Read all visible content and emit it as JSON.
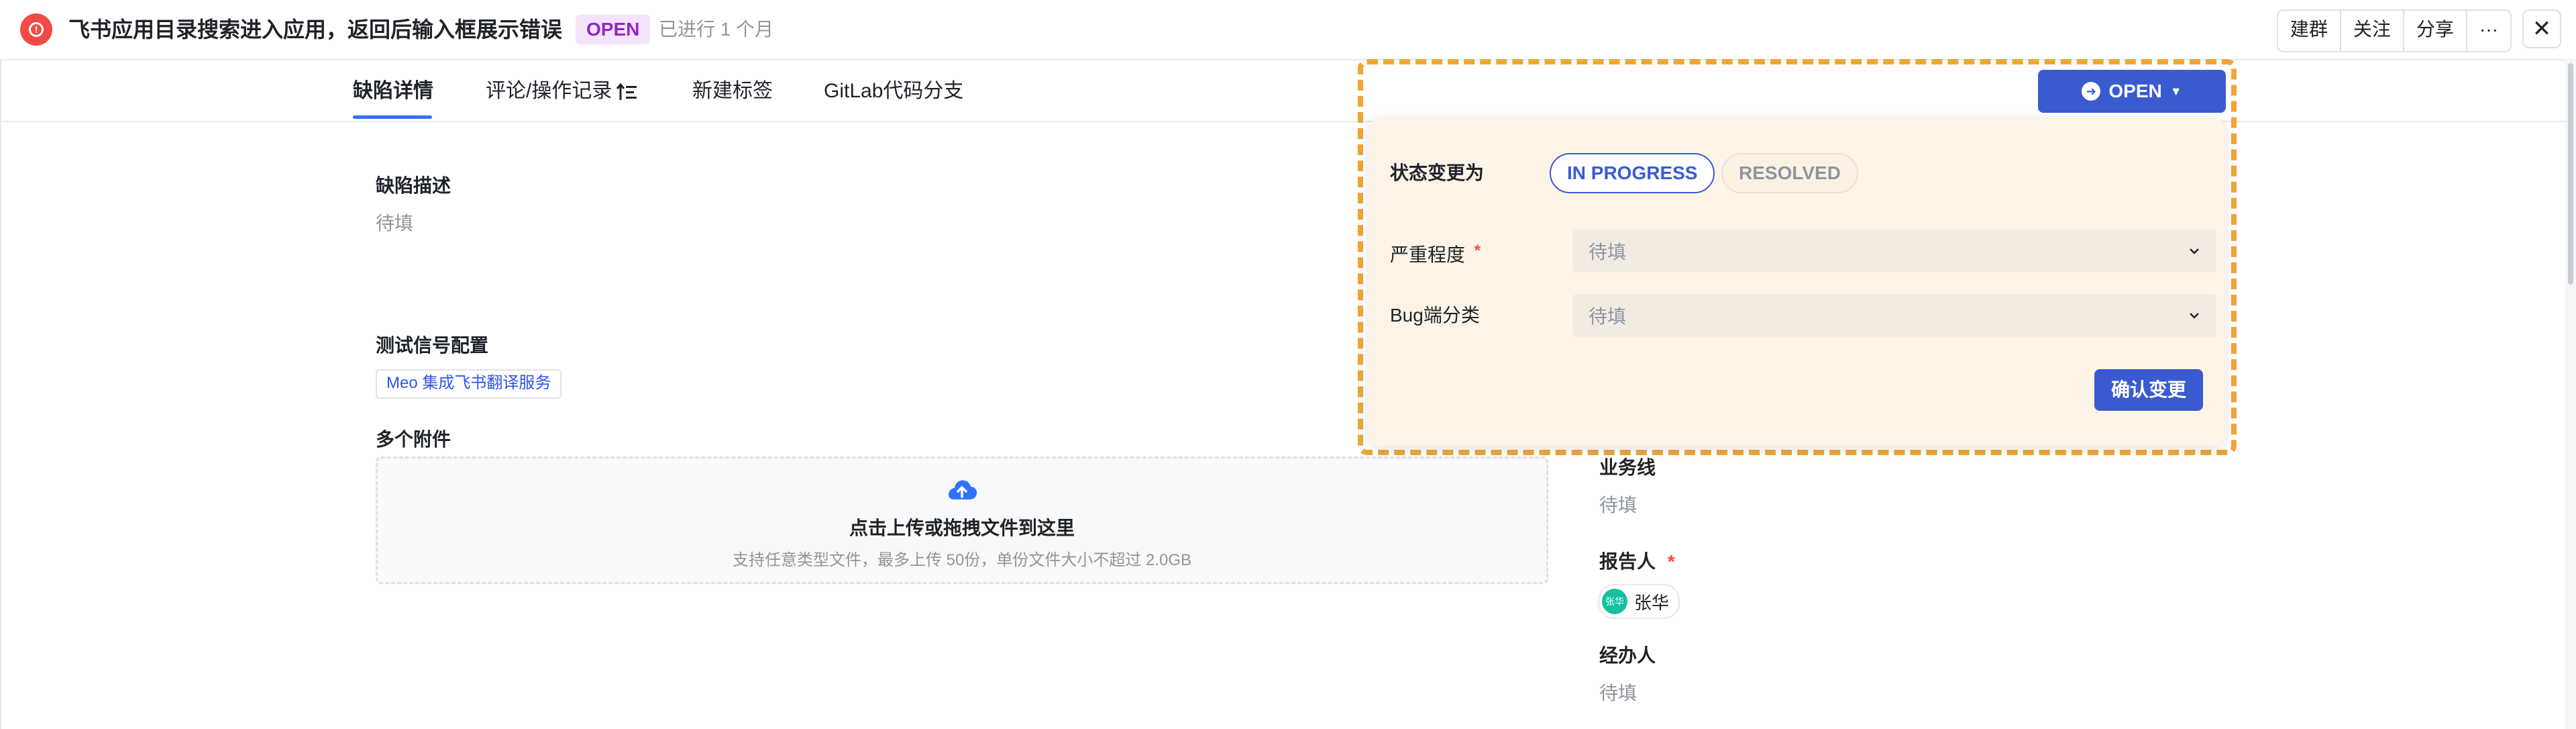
{
  "header": {
    "title": "飞书应用目录搜索进入应用，返回后输入框展示错误",
    "status_badge": "OPEN",
    "elapsed": "已进行 1 个月",
    "actions": [
      "建群",
      "关注",
      "分享",
      "···"
    ],
    "close": "✕"
  },
  "tabs": [
    {
      "label": "缺陷详情",
      "active": true
    },
    {
      "label": "评论/操作记录"
    },
    {
      "label": "新建标签"
    },
    {
      "label": "GitLab代码分支"
    }
  ],
  "left": {
    "description": {
      "label": "缺陷描述",
      "value": "待填"
    },
    "test_signal": {
      "label": "测试信号配置",
      "tag": "Meo 集成飞书翻译服务"
    },
    "attachments": {
      "label": "多个附件",
      "upload_main": "点击上传或拖拽文件到这里",
      "upload_sub": "支持任意类型文件，最多上传 50份，单份文件大小不超过 2.0GB"
    }
  },
  "right": {
    "business_line": {
      "label": "业务线",
      "value": "待填"
    },
    "reporter": {
      "label": "报告人",
      "required": "*",
      "avatar_text": "张华",
      "name": "张华"
    },
    "assignee": {
      "label": "经办人",
      "value": "待填"
    }
  },
  "status_popover": {
    "button_label": "OPEN",
    "state_change_label": "状态变更为",
    "options": [
      "IN PROGRESS",
      "RESOLVED"
    ],
    "severity": {
      "label": "严重程度",
      "required": "*",
      "placeholder": "待填"
    },
    "bug_category": {
      "label": "Bug端分类",
      "placeholder": "待填"
    },
    "confirm": "确认变更"
  },
  "colors": {
    "accent": "#3a5bcf",
    "highlight_border": "#f3a436",
    "popover_bg": "#fdf4e7",
    "open_badge_bg": "#f4e4fb",
    "open_badge_text": "#9426c5",
    "required": "#f54a45"
  }
}
